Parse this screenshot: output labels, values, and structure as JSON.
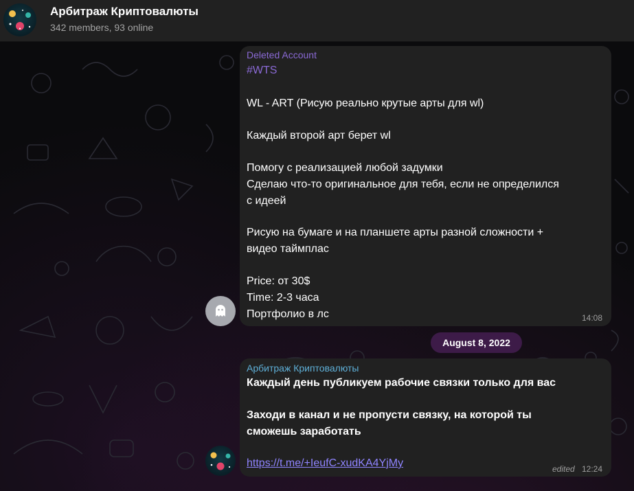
{
  "header": {
    "title": "Арбитраж Криптовалюты",
    "subtitle": "342 members, 93 online"
  },
  "messages": [
    {
      "sender": "Deleted Account",
      "sender_color": "#8b6ad6",
      "lines": [
        "#WTS",
        "WL - ART (Рисую реально крутые арты для wl)",
        "Каждый второй арт берет wl",
        "Помогу с реализацией любой задумки",
        "Сделаю что-то оригинальное для тебя, если не определился",
        "с идеей",
        "Рисую на бумаге и на планшете арты разной сложности +",
        "видео таймплас",
        "Price: от 30$",
        "Time: 2-3 часа",
        "Портфолио в лс"
      ],
      "time": "14:08"
    },
    {
      "sender": "Арбитраж Криптовалюты",
      "sender_color": "#5fb0d8",
      "lines": [
        "Каждый день публикуем рабочие связки только для вас",
        "Заходи в канал и не пропусти связку, на которой ты",
        "сможешь заработать"
      ],
      "link": "https://t.me/+IeufC-xudKA4YjMy",
      "edited": "edited",
      "time": "12:24"
    }
  ],
  "date_separator": "August 8, 2022",
  "colors": {
    "link": "#8f84ff",
    "hashtag": "#8b6ad6",
    "date_pill": "#3d1b48"
  }
}
